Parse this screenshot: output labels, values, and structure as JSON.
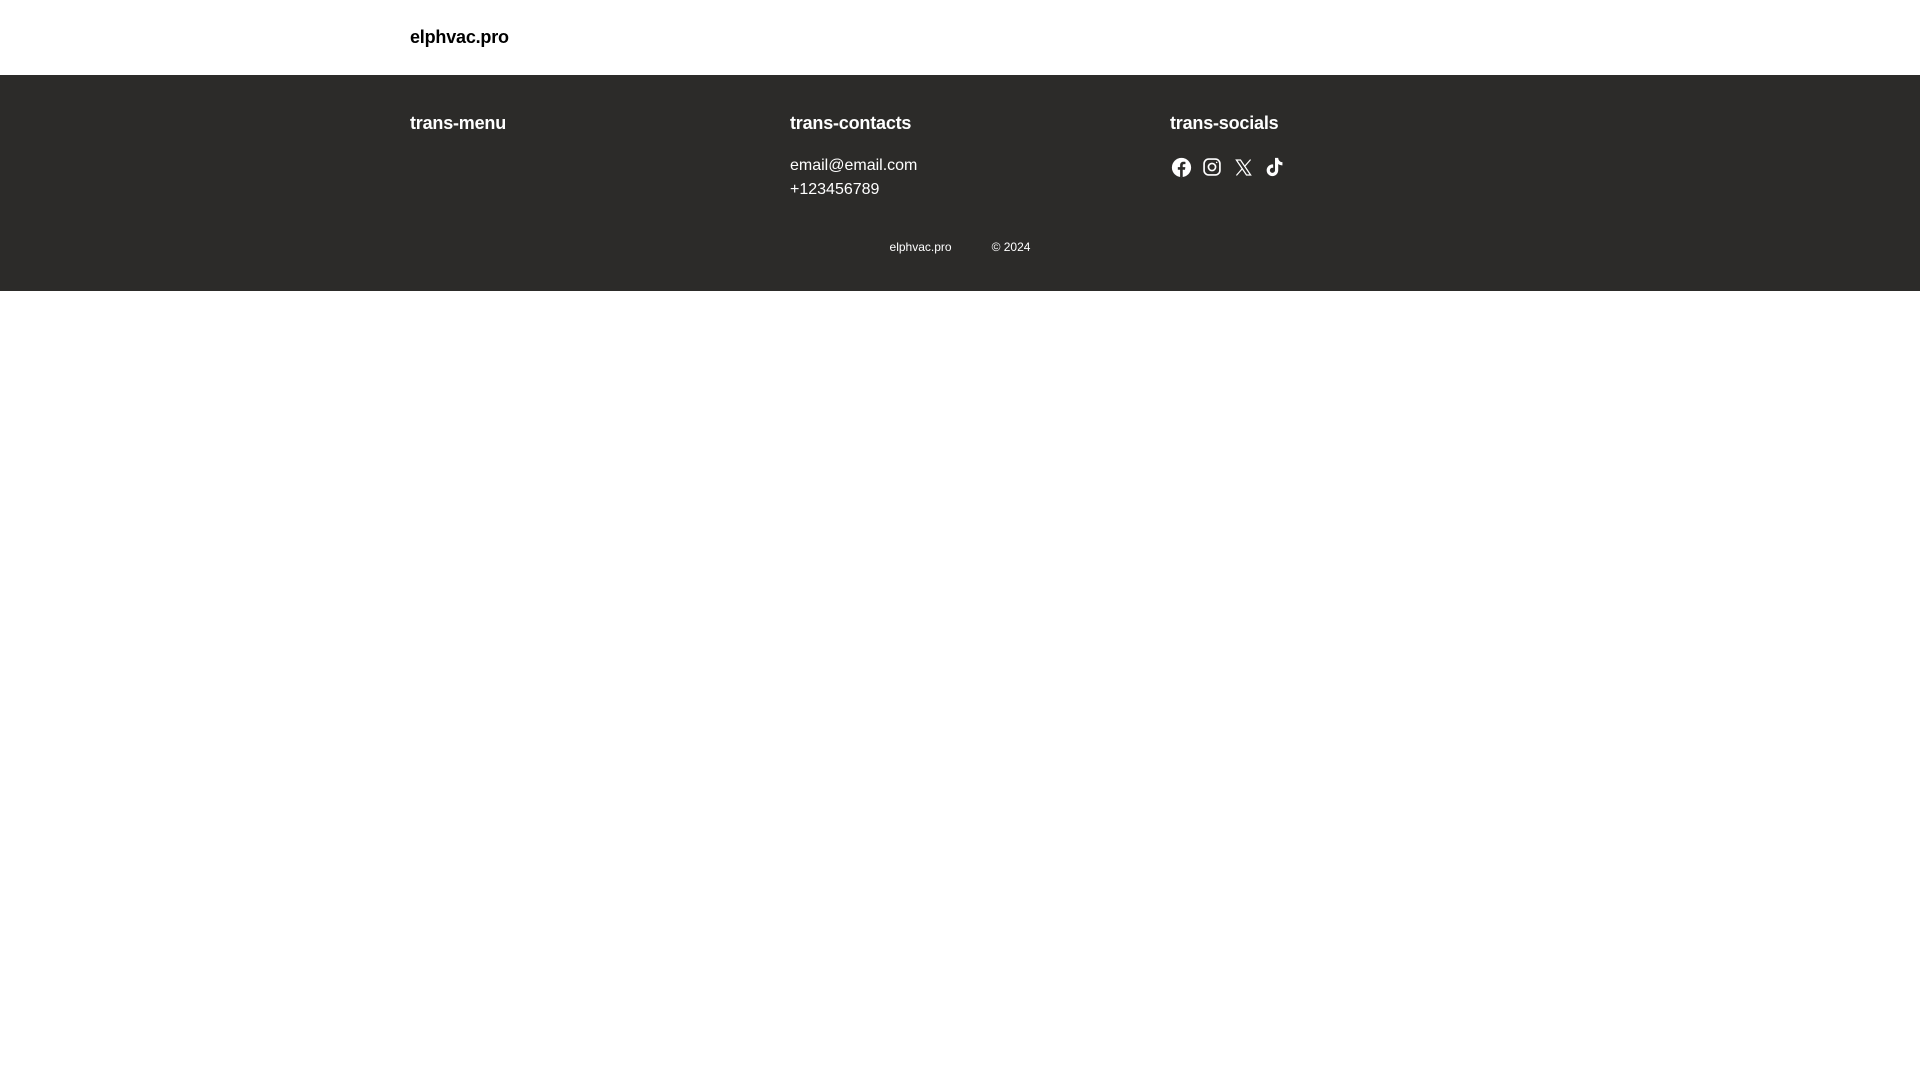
{
  "header": {
    "logo_text": "elphvac.pro"
  },
  "footer": {
    "menu": {
      "title": "trans-menu"
    },
    "contacts": {
      "title": "trans-contacts",
      "email": "email@email.com",
      "phone": "+123456789"
    },
    "socials": {
      "title": "trans-socials",
      "icons": [
        "facebook-icon",
        "instagram-icon",
        "x-twitter-icon",
        "tiktok-icon"
      ]
    },
    "bottom": {
      "site_name": "elphvac.pro",
      "copyright": "© 2024"
    }
  },
  "colors": {
    "footer_background": "#2c2b29",
    "header_background": "#ffffff",
    "footer_text": "#ffffff"
  }
}
